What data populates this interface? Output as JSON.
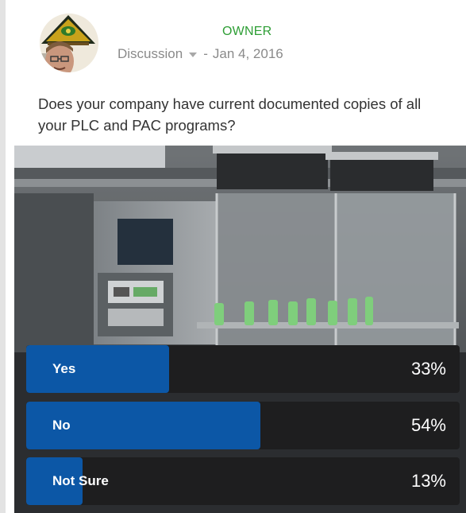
{
  "post": {
    "role_badge": "OWNER",
    "post_type": "Discussion",
    "separator": "-",
    "date": "Jan 4, 2016",
    "question": "Does your company have current documented copies of all your PLC and PAC programs?"
  },
  "icons": {
    "avatar": "avatar-with-logo",
    "dropdown": "chevron-down-icon"
  },
  "colors": {
    "owner_badge": "#2e9e35",
    "poll_fill": "#0c57a6",
    "poll_track": "#1e1e1f",
    "meta_text": "#8a8a8a"
  },
  "poll": {
    "options": [
      {
        "label": "Yes",
        "percent_text": "33%",
        "percent": 33
      },
      {
        "label": "No",
        "percent_text": "54%",
        "percent": 54
      },
      {
        "label": "Not Sure",
        "percent_text": "13%",
        "percent": 13
      }
    ]
  }
}
